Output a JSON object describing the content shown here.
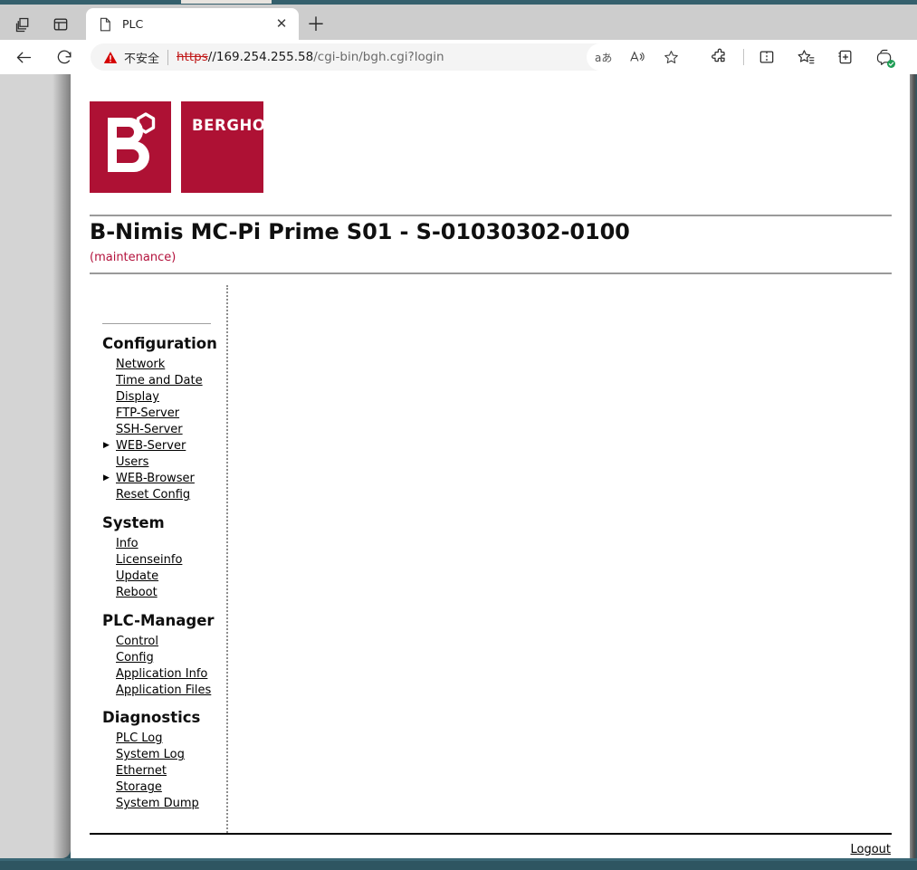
{
  "browser": {
    "tab": {
      "title": "PLC",
      "favicon_icon": "page-icon",
      "close_icon": "close-icon"
    },
    "new_tab_icon": "plus-icon",
    "workspaces_icon": "copilot-workspaces-icon",
    "split_icon": "tab-actions-icon",
    "back_icon": "back-arrow-icon",
    "reload_icon": "reload-icon",
    "address": {
      "security_icon": "warning-triangle-icon",
      "security_label": "不安全",
      "scheme": "https",
      "host": "//169.254.255.58",
      "path": "/cgi-bin/bgh.cgi?login"
    },
    "omnibox_actions": [
      {
        "name": "translate-icon",
        "glyph": "aあ"
      },
      {
        "name": "read-aloud-icon",
        "glyph": "A"
      },
      {
        "name": "favorite-star-icon",
        "glyph": "star"
      }
    ],
    "toolbar": [
      {
        "name": "extensions-icon"
      },
      {
        "name": "split-screen-icon"
      },
      {
        "name": "favorites-list-icon"
      },
      {
        "name": "collections-icon"
      },
      {
        "name": "copilot-icon"
      }
    ]
  },
  "page": {
    "logo": {
      "brand_mark": "B",
      "brand_word": "BERGHOF",
      "color": "#ae1134"
    },
    "title": "B-Nimis MC-Pi Prime S01 - S-01030302-0100",
    "subtitle": "(maintenance)",
    "subtitle_color": "#b3123c",
    "nav": [
      {
        "group": "Configuration",
        "items": [
          {
            "label": "Network",
            "expandable": false
          },
          {
            "label": "Time and Date",
            "expandable": false
          },
          {
            "label": "Display",
            "expandable": false
          },
          {
            "label": "FTP-Server",
            "expandable": false
          },
          {
            "label": "SSH-Server",
            "expandable": false
          },
          {
            "label": "WEB-Server",
            "expandable": true
          },
          {
            "label": "Users",
            "expandable": false
          },
          {
            "label": "WEB-Browser",
            "expandable": true
          },
          {
            "label": "Reset Config",
            "expandable": false
          }
        ]
      },
      {
        "group": "System",
        "items": [
          {
            "label": "Info",
            "expandable": false
          },
          {
            "label": "Licenseinfo",
            "expandable": false
          },
          {
            "label": "Update",
            "expandable": false
          },
          {
            "label": "Reboot",
            "expandable": false
          }
        ]
      },
      {
        "group": "PLC-Manager",
        "items": [
          {
            "label": "Control",
            "expandable": false
          },
          {
            "label": "Config",
            "expandable": false
          },
          {
            "label": "Application Info",
            "expandable": false
          },
          {
            "label": "Application Files",
            "expandable": false
          }
        ]
      },
      {
        "group": "Diagnostics",
        "items": [
          {
            "label": "PLC Log",
            "expandable": false
          },
          {
            "label": "System Log",
            "expandable": false
          },
          {
            "label": "Ethernet",
            "expandable": false
          },
          {
            "label": "Storage",
            "expandable": false
          },
          {
            "label": "System Dump",
            "expandable": false
          }
        ]
      }
    ],
    "footer": {
      "logout_label": "Logout"
    }
  }
}
